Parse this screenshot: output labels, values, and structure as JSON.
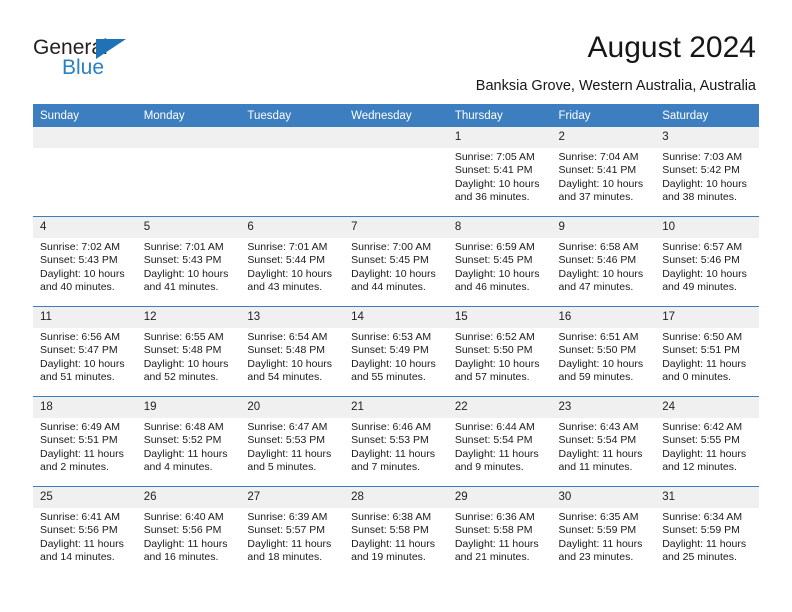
{
  "brand": {
    "name_part1": "General",
    "name_part2": "Blue",
    "accent_color": "#2980c4",
    "triangle_color": "#1f72b8"
  },
  "header": {
    "title": "August 2024",
    "subtitle": "Banksia Grove, Western Australia, Australia",
    "header_bg_color": "#3c7ebf"
  },
  "weekdays": [
    "Sunday",
    "Monday",
    "Tuesday",
    "Wednesday",
    "Thursday",
    "Friday",
    "Saturday"
  ],
  "weeks": [
    [
      {
        "day": "",
        "empty": true
      },
      {
        "day": "",
        "empty": true
      },
      {
        "day": "",
        "empty": true
      },
      {
        "day": "",
        "empty": true
      },
      {
        "day": "1",
        "sunrise": "Sunrise: 7:05 AM",
        "sunset": "Sunset: 5:41 PM",
        "daylight1": "Daylight: 10 hours",
        "daylight2": "and 36 minutes."
      },
      {
        "day": "2",
        "sunrise": "Sunrise: 7:04 AM",
        "sunset": "Sunset: 5:41 PM",
        "daylight1": "Daylight: 10 hours",
        "daylight2": "and 37 minutes."
      },
      {
        "day": "3",
        "sunrise": "Sunrise: 7:03 AM",
        "sunset": "Sunset: 5:42 PM",
        "daylight1": "Daylight: 10 hours",
        "daylight2": "and 38 minutes."
      }
    ],
    [
      {
        "day": "4",
        "sunrise": "Sunrise: 7:02 AM",
        "sunset": "Sunset: 5:43 PM",
        "daylight1": "Daylight: 10 hours",
        "daylight2": "and 40 minutes."
      },
      {
        "day": "5",
        "sunrise": "Sunrise: 7:01 AM",
        "sunset": "Sunset: 5:43 PM",
        "daylight1": "Daylight: 10 hours",
        "daylight2": "and 41 minutes."
      },
      {
        "day": "6",
        "sunrise": "Sunrise: 7:01 AM",
        "sunset": "Sunset: 5:44 PM",
        "daylight1": "Daylight: 10 hours",
        "daylight2": "and 43 minutes."
      },
      {
        "day": "7",
        "sunrise": "Sunrise: 7:00 AM",
        "sunset": "Sunset: 5:45 PM",
        "daylight1": "Daylight: 10 hours",
        "daylight2": "and 44 minutes."
      },
      {
        "day": "8",
        "sunrise": "Sunrise: 6:59 AM",
        "sunset": "Sunset: 5:45 PM",
        "daylight1": "Daylight: 10 hours",
        "daylight2": "and 46 minutes."
      },
      {
        "day": "9",
        "sunrise": "Sunrise: 6:58 AM",
        "sunset": "Sunset: 5:46 PM",
        "daylight1": "Daylight: 10 hours",
        "daylight2": "and 47 minutes."
      },
      {
        "day": "10",
        "sunrise": "Sunrise: 6:57 AM",
        "sunset": "Sunset: 5:46 PM",
        "daylight1": "Daylight: 10 hours",
        "daylight2": "and 49 minutes."
      }
    ],
    [
      {
        "day": "11",
        "sunrise": "Sunrise: 6:56 AM",
        "sunset": "Sunset: 5:47 PM",
        "daylight1": "Daylight: 10 hours",
        "daylight2": "and 51 minutes."
      },
      {
        "day": "12",
        "sunrise": "Sunrise: 6:55 AM",
        "sunset": "Sunset: 5:48 PM",
        "daylight1": "Daylight: 10 hours",
        "daylight2": "and 52 minutes."
      },
      {
        "day": "13",
        "sunrise": "Sunrise: 6:54 AM",
        "sunset": "Sunset: 5:48 PM",
        "daylight1": "Daylight: 10 hours",
        "daylight2": "and 54 minutes."
      },
      {
        "day": "14",
        "sunrise": "Sunrise: 6:53 AM",
        "sunset": "Sunset: 5:49 PM",
        "daylight1": "Daylight: 10 hours",
        "daylight2": "and 55 minutes."
      },
      {
        "day": "15",
        "sunrise": "Sunrise: 6:52 AM",
        "sunset": "Sunset: 5:50 PM",
        "daylight1": "Daylight: 10 hours",
        "daylight2": "and 57 minutes."
      },
      {
        "day": "16",
        "sunrise": "Sunrise: 6:51 AM",
        "sunset": "Sunset: 5:50 PM",
        "daylight1": "Daylight: 10 hours",
        "daylight2": "and 59 minutes."
      },
      {
        "day": "17",
        "sunrise": "Sunrise: 6:50 AM",
        "sunset": "Sunset: 5:51 PM",
        "daylight1": "Daylight: 11 hours",
        "daylight2": "and 0 minutes."
      }
    ],
    [
      {
        "day": "18",
        "sunrise": "Sunrise: 6:49 AM",
        "sunset": "Sunset: 5:51 PM",
        "daylight1": "Daylight: 11 hours",
        "daylight2": "and 2 minutes."
      },
      {
        "day": "19",
        "sunrise": "Sunrise: 6:48 AM",
        "sunset": "Sunset: 5:52 PM",
        "daylight1": "Daylight: 11 hours",
        "daylight2": "and 4 minutes."
      },
      {
        "day": "20",
        "sunrise": "Sunrise: 6:47 AM",
        "sunset": "Sunset: 5:53 PM",
        "daylight1": "Daylight: 11 hours",
        "daylight2": "and 5 minutes."
      },
      {
        "day": "21",
        "sunrise": "Sunrise: 6:46 AM",
        "sunset": "Sunset: 5:53 PM",
        "daylight1": "Daylight: 11 hours",
        "daylight2": "and 7 minutes."
      },
      {
        "day": "22",
        "sunrise": "Sunrise: 6:44 AM",
        "sunset": "Sunset: 5:54 PM",
        "daylight1": "Daylight: 11 hours",
        "daylight2": "and 9 minutes."
      },
      {
        "day": "23",
        "sunrise": "Sunrise: 6:43 AM",
        "sunset": "Sunset: 5:54 PM",
        "daylight1": "Daylight: 11 hours",
        "daylight2": "and 11 minutes."
      },
      {
        "day": "24",
        "sunrise": "Sunrise: 6:42 AM",
        "sunset": "Sunset: 5:55 PM",
        "daylight1": "Daylight: 11 hours",
        "daylight2": "and 12 minutes."
      }
    ],
    [
      {
        "day": "25",
        "sunrise": "Sunrise: 6:41 AM",
        "sunset": "Sunset: 5:56 PM",
        "daylight1": "Daylight: 11 hours",
        "daylight2": "and 14 minutes."
      },
      {
        "day": "26",
        "sunrise": "Sunrise: 6:40 AM",
        "sunset": "Sunset: 5:56 PM",
        "daylight1": "Daylight: 11 hours",
        "daylight2": "and 16 minutes."
      },
      {
        "day": "27",
        "sunrise": "Sunrise: 6:39 AM",
        "sunset": "Sunset: 5:57 PM",
        "daylight1": "Daylight: 11 hours",
        "daylight2": "and 18 minutes."
      },
      {
        "day": "28",
        "sunrise": "Sunrise: 6:38 AM",
        "sunset": "Sunset: 5:58 PM",
        "daylight1": "Daylight: 11 hours",
        "daylight2": "and 19 minutes."
      },
      {
        "day": "29",
        "sunrise": "Sunrise: 6:36 AM",
        "sunset": "Sunset: 5:58 PM",
        "daylight1": "Daylight: 11 hours",
        "daylight2": "and 21 minutes."
      },
      {
        "day": "30",
        "sunrise": "Sunrise: 6:35 AM",
        "sunset": "Sunset: 5:59 PM",
        "daylight1": "Daylight: 11 hours",
        "daylight2": "and 23 minutes."
      },
      {
        "day": "31",
        "sunrise": "Sunrise: 6:34 AM",
        "sunset": "Sunset: 5:59 PM",
        "daylight1": "Daylight: 11 hours",
        "daylight2": "and 25 minutes."
      }
    ]
  ]
}
